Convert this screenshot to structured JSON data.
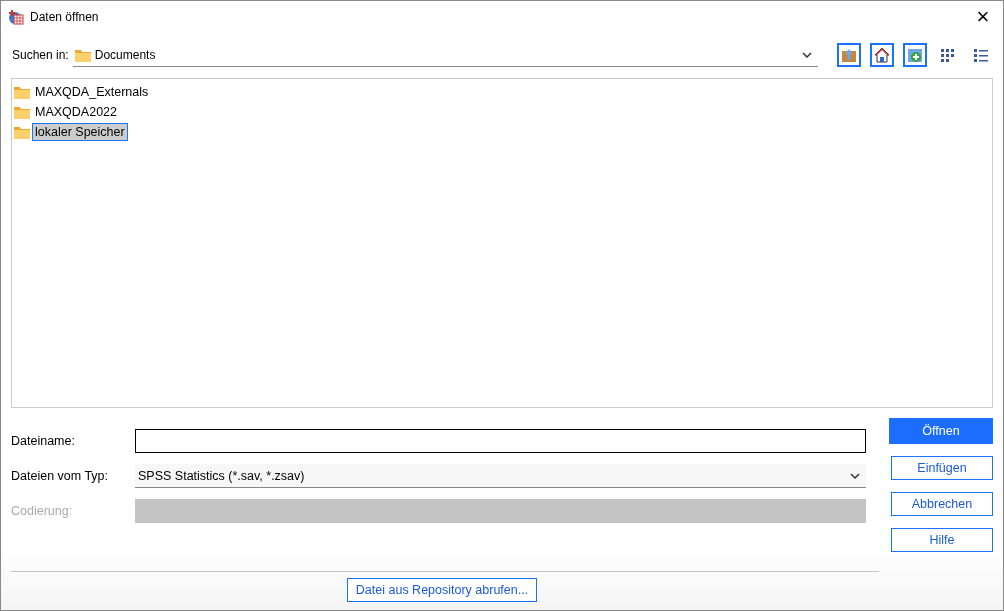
{
  "window": {
    "title": "Daten öffnen",
    "close": "×"
  },
  "look_in": {
    "label": "Suchen in:",
    "value": "Documents"
  },
  "files": [
    {
      "name": "MAXQDA_Externals",
      "selected": false
    },
    {
      "name": "MAXQDA2022",
      "selected": false
    },
    {
      "name": "lokaler Speicher",
      "selected": true
    }
  ],
  "fields": [
    {
      "kind": "text",
      "label": "Dateiname:",
      "disabled": false
    },
    {
      "kind": "dropdown",
      "label": "Dateien vom Typ:",
      "value": "SPSS Statistics (*.sav, *.zsav)",
      "disabled": false
    },
    {
      "kind": "dropdown",
      "label": "Codierung:",
      "disabled": true
    }
  ],
  "buttons": [
    {
      "label": "Öffnen",
      "default": true
    },
    {
      "label": "Einfügen",
      "default": false
    },
    {
      "label": "Abbrechen",
      "default": false
    },
    {
      "label": "Hilfe",
      "default": false
    }
  ],
  "repository_button": "Datei aus Repository abrufen..."
}
